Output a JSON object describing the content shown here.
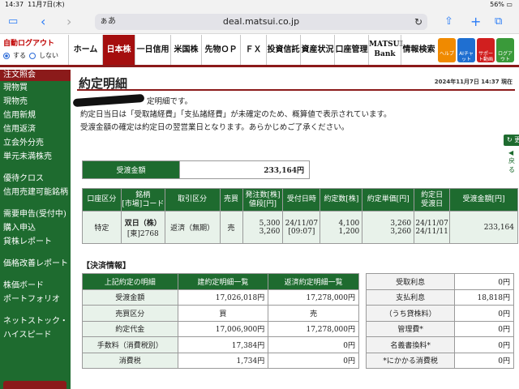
{
  "status": {
    "time": "14:37",
    "date": "11月7日(木)",
    "battery": "56%"
  },
  "browser": {
    "aa": "ぁあ",
    "url": "deal.matsui.co.jp"
  },
  "autologout": {
    "title": "自動ログアウト",
    "on": "する",
    "off": "しない"
  },
  "nav": [
    "ホーム",
    "日本株",
    "一日信用",
    "米国株",
    "先物ＯＰ",
    "ＦＸ",
    "投資信託",
    "資産状況",
    "口座管理",
    "MATSUI Bank",
    "情報検索"
  ],
  "quick": [
    {
      "label": "ヘルプ",
      "color": "#f08a00"
    },
    {
      "label": "AIチャット",
      "color": "#1f6fd1"
    },
    {
      "label": "サポート動画",
      "color": "#d11f1f"
    },
    {
      "label": "ログアウト",
      "color": "#3a9a3a"
    }
  ],
  "sidebar": {
    "head": "注文照会",
    "items": [
      "現物買",
      "現物売",
      "信用新規",
      "信用返済",
      "立会外分売",
      "単元未満株売"
    ],
    "items2": [
      "優待クロス",
      "信用売建可能銘柄"
    ],
    "items3": [
      "需要申告(受付中)",
      "購入申込",
      "貸株レポート"
    ],
    "items4": [
      "価格改善レポート"
    ],
    "items5": [
      "株価ボード",
      "ポートフォリオ"
    ],
    "items6": [
      "ネットストック・",
      "ハイスピード"
    ]
  },
  "page": {
    "title": "約定明細",
    "datetime": "2024年11月7日 14:37 現在",
    "msg1": "定明細です。",
    "msg2": "約定日当日は「受取諸経費」「支払諸経費」が未確定のため、概算値で表示されています。",
    "msg3": "受渡金額の確定は約定日の翌営業日となります。あらかじめご了承ください。",
    "update": "更新",
    "back": "戻る"
  },
  "amount": {
    "label": "受渡金額",
    "value": "233,164円"
  },
  "detail": {
    "headers": [
      "口座区分",
      "銘柄\n[市場]コード",
      "取引区分",
      "売買",
      "発注数[株]\n値段[円]",
      "受付日時",
      "約定数[株]",
      "約定単価[円]",
      "約定日\n受渡日",
      "受渡金額[円]"
    ],
    "row": {
      "account": "特定",
      "stock": "双日（株）",
      "code": "[東]2768",
      "type": "返済（無期）",
      "side": "売",
      "qty": "5,300",
      "price": "3,260",
      "recv_date": "24/11/07",
      "recv_time": "[09:07]",
      "exec1": "4,100",
      "exec2": "1,200",
      "unit1": "3,260",
      "unit2": "3,260",
      "trade_date": "24/11/07",
      "settle_date": "24/11/11",
      "amount": "233,164"
    }
  },
  "settle": {
    "label": "【決済情報】",
    "headers": [
      "上記約定の明細",
      "建約定明細一覧",
      "返済約定明細一覧"
    ],
    "rows": [
      {
        "k": "受渡金額",
        "a": "17,026,018円",
        "b": "17,278,000円"
      },
      {
        "k": "売買区分",
        "a": "買",
        "b": "売"
      },
      {
        "k": "約定代金",
        "a": "17,006,900円",
        "b": "17,278,000円"
      },
      {
        "k": "手数料（消費税別）",
        "a": "17,384円",
        "b": "0円"
      },
      {
        "k": "消費税",
        "a": "1,734円",
        "b": "0円"
      }
    ]
  },
  "interest": [
    {
      "k": "受取利息",
      "v": "0円"
    },
    {
      "k": "支払利息",
      "v": "18,818円"
    },
    {
      "k": "（うち貸株料）",
      "v": "0円"
    },
    {
      "k": "管理費*",
      "v": "0円"
    },
    {
      "k": "名義書換料*",
      "v": "0円"
    },
    {
      "k": "*にかかる消費税",
      "v": "0円"
    }
  ]
}
